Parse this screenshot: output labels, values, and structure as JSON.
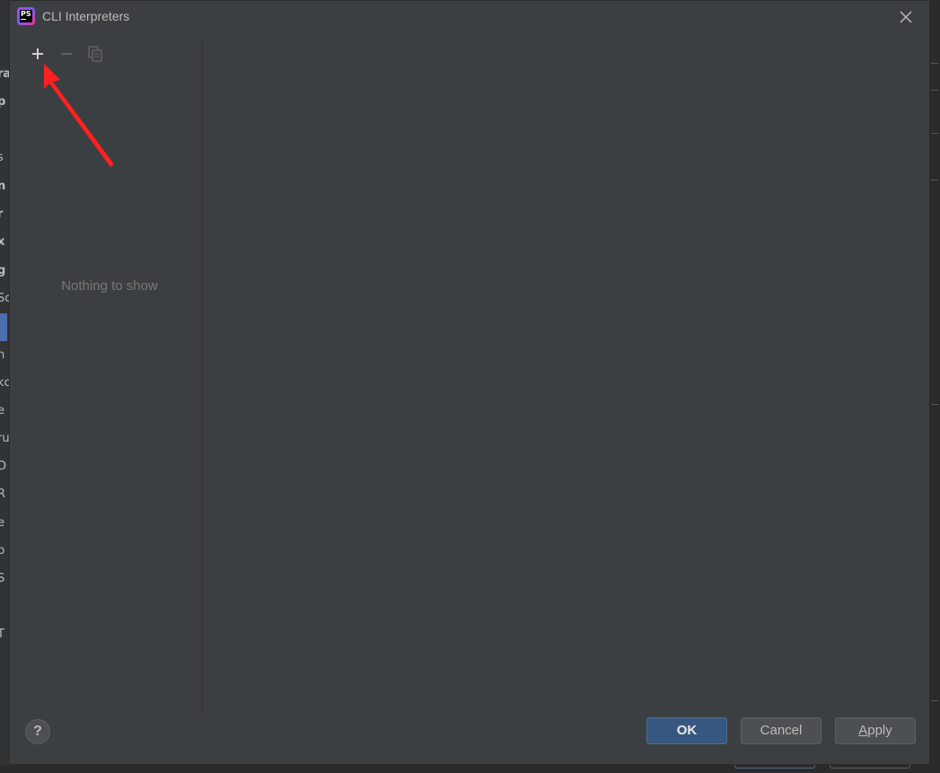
{
  "window": {
    "title": "CLI Interpreters",
    "app_icon_label": "PS"
  },
  "toolbar": {
    "add_icon": "plus-icon",
    "remove_icon": "minus-icon",
    "copy_icon": "copy-icon"
  },
  "list": {
    "empty_text": "Nothing to show"
  },
  "footer": {
    "help_label": "?",
    "ok_label": "OK",
    "cancel_label": "Cancel",
    "apply_first": "A",
    "apply_rest": "pply"
  },
  "background_fragments": [
    {
      "text": "ra",
      "bold": true
    },
    {
      "text": "p",
      "bold": true
    },
    {
      "text": "s",
      "bold": false
    },
    {
      "text": "n",
      "bold": true
    },
    {
      "text": "r",
      "bold": true
    },
    {
      "text": "x",
      "bold": true
    },
    {
      "text": "g",
      "bold": true
    },
    {
      "text": "Sc",
      "bold": false
    },
    {
      "text": "n",
      "bold": false
    },
    {
      "text": "kc",
      "bold": false
    },
    {
      "text": "e",
      "bold": false
    },
    {
      "text": "ru",
      "bold": false
    },
    {
      "text": "D",
      "bold": false
    },
    {
      "text": "R",
      "bold": false
    },
    {
      "text": "e",
      "bold": false
    },
    {
      "text": "p",
      "bold": false
    },
    {
      "text": "S",
      "bold": false
    },
    {
      "text": "T",
      "bold": false
    }
  ],
  "colors": {
    "dialog_bg": "#3c3f41",
    "primary_button": "#365880",
    "annotation_arrow": "#ff2020"
  }
}
